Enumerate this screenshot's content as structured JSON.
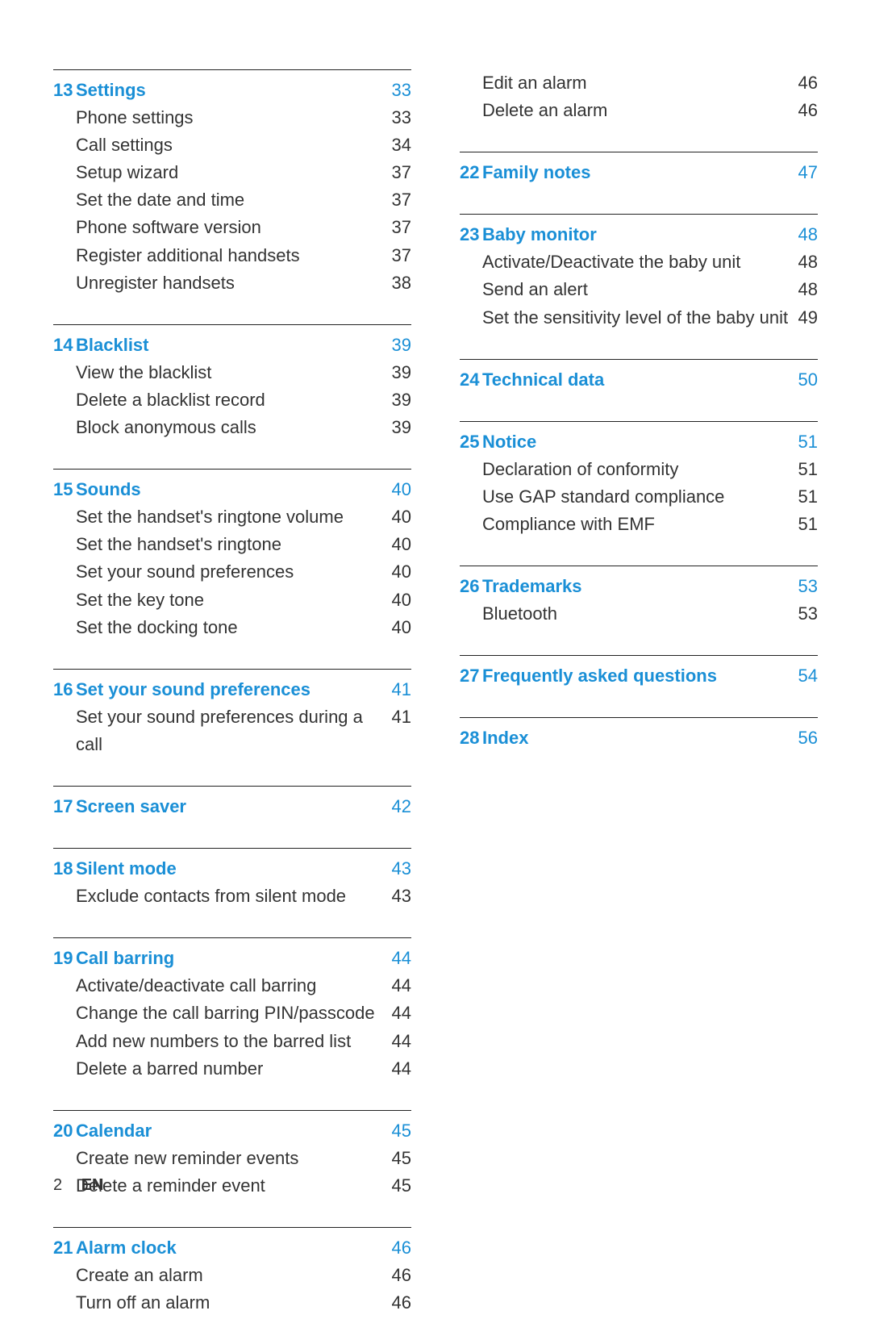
{
  "footer": {
    "page": "2",
    "lang": "EN"
  },
  "left": [
    {
      "num": "13",
      "title": "Settings",
      "page": "33",
      "items": [
        {
          "title": "Phone settings",
          "page": "33"
        },
        {
          "title": "Call settings",
          "page": "34"
        },
        {
          "title": "Setup wizard",
          "page": "37"
        },
        {
          "title": "Set the date and time",
          "page": "37"
        },
        {
          "title": "Phone software version",
          "page": "37"
        },
        {
          "title": "Register additional handsets",
          "page": "37"
        },
        {
          "title": "Unregister handsets",
          "page": "38"
        }
      ]
    },
    {
      "num": "14",
      "title": "Blacklist",
      "page": "39",
      "items": [
        {
          "title": "View the blacklist",
          "page": "39"
        },
        {
          "title": "Delete a blacklist record",
          "page": "39"
        },
        {
          "title": "Block anonymous calls",
          "page": "39"
        }
      ]
    },
    {
      "num": "15",
      "title": "Sounds",
      "page": "40",
      "items": [
        {
          "title": "Set the handset's ringtone volume",
          "page": "40"
        },
        {
          "title": "Set the handset's ringtone",
          "page": "40"
        },
        {
          "title": "Set your sound preferences",
          "page": "40"
        },
        {
          "title": "Set the key tone",
          "page": "40"
        },
        {
          "title": "Set the docking tone",
          "page": "40"
        }
      ]
    },
    {
      "num": "16",
      "title": "Set your sound preferences",
      "page": "41",
      "items": [
        {
          "title": "Set your sound preferences during a call",
          "page": "41"
        }
      ]
    },
    {
      "num": "17",
      "title": "Screen saver",
      "page": "42",
      "items": []
    },
    {
      "num": "18",
      "title": "Silent mode",
      "page": "43",
      "items": [
        {
          "title": "Exclude contacts from silent mode",
          "page": "43"
        }
      ]
    },
    {
      "num": "19",
      "title": "Call barring",
      "page": "44",
      "items": [
        {
          "title": "Activate/deactivate call barring",
          "page": "44"
        },
        {
          "title": "Change the call barring PIN/passcode",
          "page": "44"
        },
        {
          "title": "Add new numbers to the barred list",
          "page": "44"
        },
        {
          "title": "Delete a barred number",
          "page": "44"
        }
      ]
    },
    {
      "num": "20",
      "title": "Calendar",
      "page": "45",
      "items": [
        {
          "title": "Create new reminder events",
          "page": "45"
        },
        {
          "title": "Delete a reminder event",
          "page": "45"
        }
      ]
    },
    {
      "num": "21",
      "title": "Alarm clock",
      "page": "46",
      "items": [
        {
          "title": "Create an alarm",
          "page": "46"
        },
        {
          "title": "Turn off an alarm",
          "page": "46"
        }
      ]
    }
  ],
  "right_continuation": [
    {
      "title": "Edit an alarm",
      "page": "46"
    },
    {
      "title": "Delete an alarm",
      "page": "46"
    }
  ],
  "right": [
    {
      "num": "22",
      "title": "Family notes",
      "page": "47",
      "items": []
    },
    {
      "num": "23",
      "title": "Baby monitor",
      "page": "48",
      "items": [
        {
          "title": "Activate/Deactivate the baby unit",
          "page": "48"
        },
        {
          "title": "Send an alert",
          "page": "48"
        },
        {
          "title": "Set the sensitivity level of the baby unit",
          "page": "49"
        }
      ]
    },
    {
      "num": "24",
      "title": "Technical data",
      "page": "50",
      "items": []
    },
    {
      "num": "25",
      "title": "Notice",
      "page": "51",
      "items": [
        {
          "title": "Declaration of conformity",
          "page": "51"
        },
        {
          "title": "Use GAP standard compliance",
          "page": "51"
        },
        {
          "title": "Compliance with EMF",
          "page": "51"
        }
      ]
    },
    {
      "num": "26",
      "title": "Trademarks",
      "page": "53",
      "items": [
        {
          "title": "Bluetooth",
          "page": "53"
        }
      ]
    },
    {
      "num": "27",
      "title": "Frequently asked questions",
      "page": "54",
      "items": []
    },
    {
      "num": "28",
      "title": "Index",
      "page": "56",
      "items": []
    }
  ]
}
